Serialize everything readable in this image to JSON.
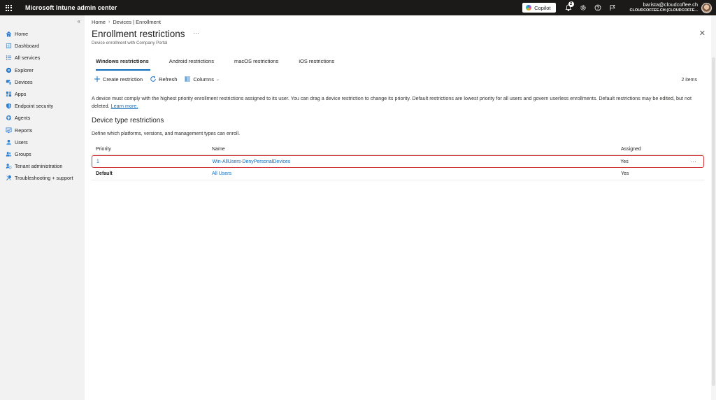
{
  "topbar": {
    "app_title": "Microsoft Intune admin center",
    "copilot_label": "Copilot",
    "notification_count": "2",
    "account_email": "barista@cloudcoffee.ch",
    "account_tenant": "CLOUDCOFFEE.CH (CLOUDCOFFE..."
  },
  "sidebar": {
    "collapse_glyph": "«",
    "items": [
      {
        "label": "Home",
        "icon": "home-icon"
      },
      {
        "label": "Dashboard",
        "icon": "dashboard-icon"
      },
      {
        "label": "All services",
        "icon": "all-services-icon"
      },
      {
        "label": "Explorer",
        "icon": "explorer-icon"
      },
      {
        "label": "Devices",
        "icon": "devices-icon"
      },
      {
        "label": "Apps",
        "icon": "apps-icon"
      },
      {
        "label": "Endpoint security",
        "icon": "shield-icon"
      },
      {
        "label": "Agents",
        "icon": "agents-icon"
      },
      {
        "label": "Reports",
        "icon": "reports-icon"
      },
      {
        "label": "Users",
        "icon": "users-icon"
      },
      {
        "label": "Groups",
        "icon": "groups-icon"
      },
      {
        "label": "Tenant administration",
        "icon": "tenant-admin-icon"
      },
      {
        "label": "Troubleshooting + support",
        "icon": "troubleshooting-icon"
      }
    ]
  },
  "breadcrumb": {
    "home": "Home",
    "current": "Devices | Enrollment"
  },
  "page": {
    "title": "Enrollment restrictions",
    "subtitle": "Device enrollment with Company Portal"
  },
  "tabs": [
    {
      "label": "Windows restrictions",
      "active": true
    },
    {
      "label": "Android restrictions",
      "active": false
    },
    {
      "label": "macOS restrictions",
      "active": false
    },
    {
      "label": "iOS restrictions",
      "active": false
    }
  ],
  "toolbar": {
    "create_label": "Create restriction",
    "refresh_label": "Refresh",
    "columns_label": "Columns",
    "item_count": "2 items"
  },
  "info": {
    "text": "A device must comply with the highest priority enrollment restrictions assigned to its user. You can drag a device restriction to change its priority. Default restrictions are lowest priority for all users and govern userless enrollments. Default restrictions may be edited, but not deleted.",
    "link": "Learn more."
  },
  "section": {
    "title": "Device type restrictions",
    "description": "Define which platforms, versions, and management types can enroll."
  },
  "table": {
    "headers": [
      "Priority",
      "Name",
      "Assigned"
    ],
    "rows": [
      {
        "priority": "1",
        "name": "Win-AllUsers-DenyPersonalDevices",
        "assigned": "Yes"
      },
      {
        "priority": "Default",
        "name": "All Users",
        "assigned": "Yes"
      }
    ]
  },
  "colors": {
    "accent": "#0f6cbd",
    "highlight_border": "#d13438",
    "topbar_bg": "#1b1a19"
  }
}
